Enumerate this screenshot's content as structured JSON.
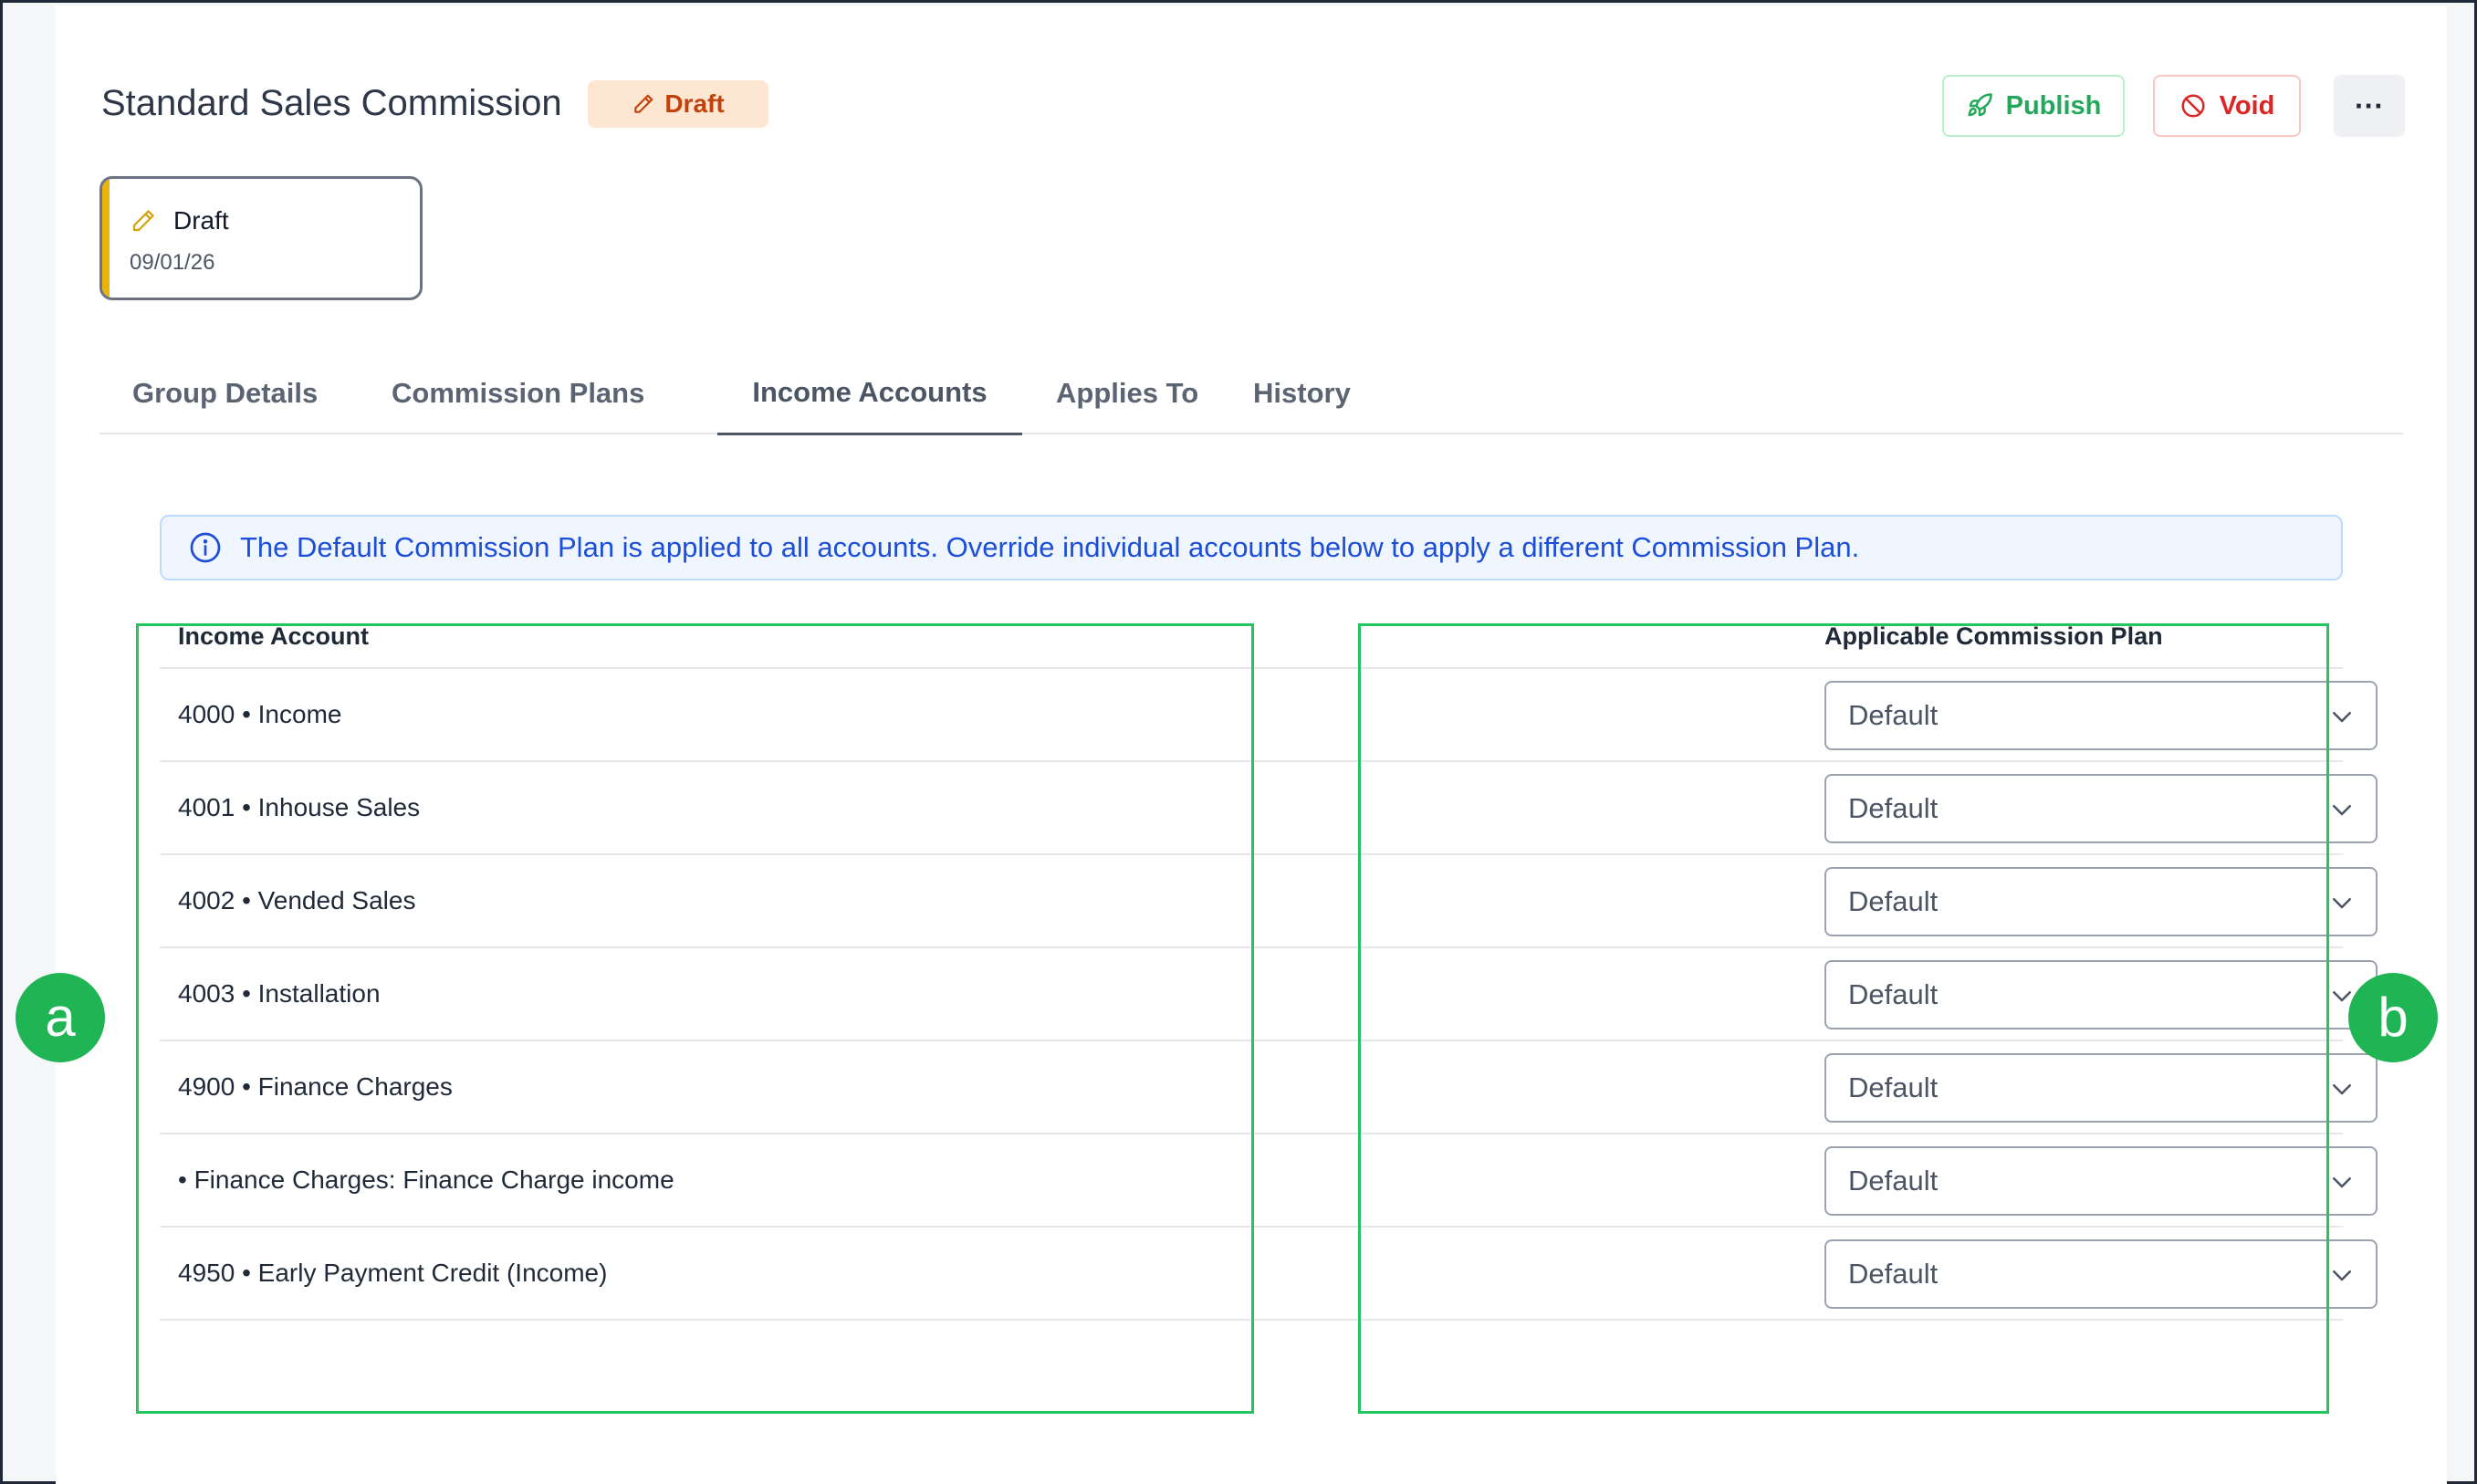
{
  "header": {
    "title": "Standard Sales Commission",
    "status": "Draft",
    "publish_label": "Publish",
    "void_label": "Void",
    "more_label": "···"
  },
  "version": {
    "label": "Draft",
    "date": "09/01/26"
  },
  "tabs": [
    {
      "label": "Group Details"
    },
    {
      "label": "Commission Plans"
    },
    {
      "label": "Income Accounts",
      "active": true
    },
    {
      "label": "Applies To"
    },
    {
      "label": "History"
    }
  ],
  "info_text": "The Default Commission Plan is applied to all accounts. Override individual accounts below to apply a different Commission Plan.",
  "table": {
    "col_account": "Income Account",
    "col_plan": "Applicable Commission Plan",
    "rows": [
      {
        "account": "4000 • Income",
        "plan": "Default"
      },
      {
        "account": "4001 • Inhouse Sales",
        "plan": "Default"
      },
      {
        "account": "4002 • Vended Sales",
        "plan": "Default"
      },
      {
        "account": "4003 • Installation",
        "plan": "Default"
      },
      {
        "account": "4900 • Finance Charges",
        "plan": "Default"
      },
      {
        "account": "• Finance Charges: Finance Charge income",
        "plan": "Default"
      },
      {
        "account": "4950 • Early Payment Credit (Income)",
        "plan": "Default"
      }
    ]
  },
  "callouts": {
    "a": "a",
    "b": "b"
  },
  "colors": {
    "accent_green": "#22c55e",
    "draft_orange": "#c2410c",
    "publish_green": "#22a85a",
    "void_red": "#dc2626",
    "info_blue": "#1d4ed8"
  },
  "icons": {
    "status": "pencil-icon",
    "publish": "rocket-icon",
    "void": "ban-icon",
    "more": "ellipsis-icon",
    "info": "info-icon",
    "select": "chevron-down-icon"
  }
}
